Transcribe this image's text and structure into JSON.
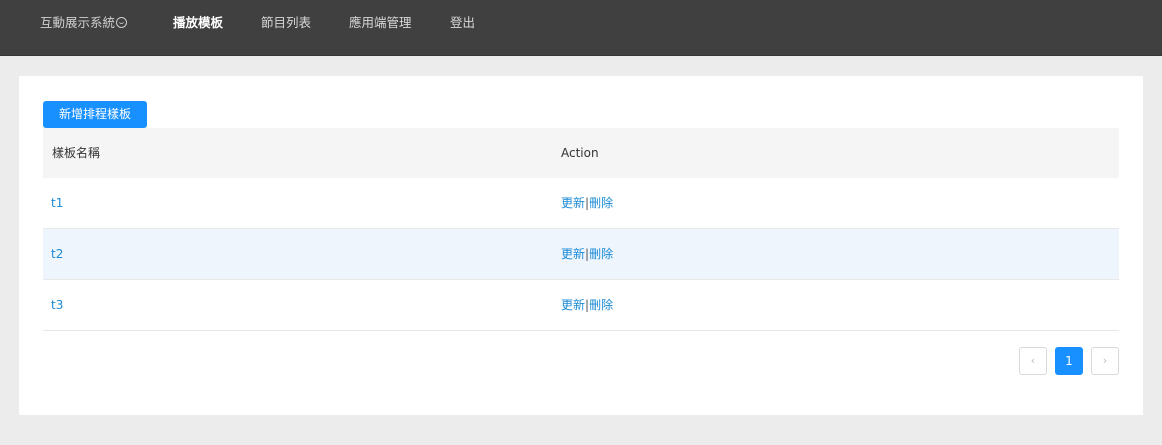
{
  "nav": {
    "brand": "互動展示系統",
    "items": [
      "播放模板",
      "節目列表",
      "應用端管理",
      "登出"
    ]
  },
  "toolbar": {
    "add_label": "新增排程樣板"
  },
  "table": {
    "columns": [
      "樣板名稱",
      "Action"
    ],
    "rows": [
      {
        "name": "t1",
        "update": "更新",
        "sep": "|",
        "delete": "刪除"
      },
      {
        "name": "t2",
        "update": "更新",
        "sep": "|",
        "delete": "刪除"
      },
      {
        "name": "t3",
        "update": "更新",
        "sep": "|",
        "delete": "刪除"
      }
    ]
  },
  "pagination": {
    "prev": "‹",
    "current": "1",
    "next": "›"
  },
  "colors": {
    "accent": "#1890ff",
    "link": "#1a8ad6",
    "topbar": "#404040"
  }
}
